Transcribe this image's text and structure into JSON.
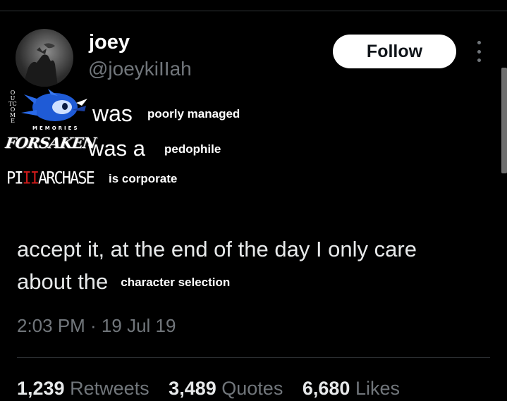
{
  "user": {
    "display_name": "joey",
    "handle": "@joeykiIIah"
  },
  "follow_label": "Follow",
  "meme": {
    "row1": {
      "logo_vertical": "OUTCOME",
      "logo_sub": "MEMORIES",
      "was": "was",
      "small": "poorly managed"
    },
    "row2": {
      "logo": "FORSAKEN",
      "was": "was a",
      "small": "pedophile"
    },
    "row3": {
      "logo_a": "PI",
      "logo_b": "II",
      "logo_c": "ARCHASE",
      "small": "is corporate"
    }
  },
  "body": {
    "text": "accept it, at the end of the day I only care about the",
    "small": "character selection"
  },
  "timestamp": "2:03 PM · 19 Jul 19",
  "stats": {
    "retweets_count": "1,239",
    "retweets_label": "Retweets",
    "quotes_count": "3,489",
    "quotes_label": "Quotes",
    "likes_count": "6,680",
    "likes_label": "Likes"
  },
  "colors": {
    "background": "#000000",
    "muted": "#71767b",
    "text": "#e7e9ea"
  },
  "icons": [
    "more-options-icon",
    "sonic-character-image",
    "avatar-image"
  ]
}
